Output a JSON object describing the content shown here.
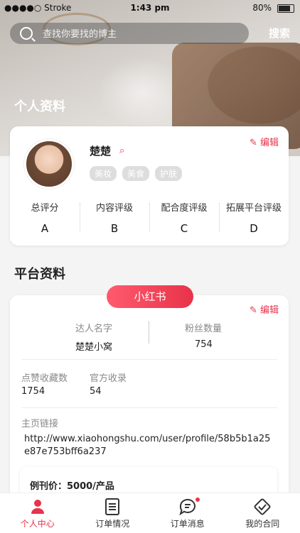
{
  "status_bar": {
    "carrier": "●●●●○ Stroke",
    "time": "1:43 pm",
    "battery": "80%"
  },
  "search": {
    "placeholder": "查找你要找的博主",
    "button_label": "搜索"
  },
  "personal": {
    "section_title": "个人资料",
    "edit_label": "编辑",
    "name": "楚楚",
    "tags": [
      "美妆",
      "美食",
      "护肤"
    ],
    "grades": [
      {
        "label": "总评分",
        "value": "A"
      },
      {
        "label": "内容评级",
        "value": "B"
      },
      {
        "label": "配合度评级",
        "value": "C"
      },
      {
        "label": "拓展平台评级",
        "value": "D"
      }
    ]
  },
  "platform": {
    "section_title": "平台资料",
    "platform_name": "小红书",
    "edit_label": "编辑",
    "creator_name_label": "达人名字",
    "creator_name": "楚楚小窝",
    "followers_label": "粉丝数量",
    "followers": "754",
    "likes_label": "点赞收藏数",
    "likes": "1754",
    "official_label": "官方收录",
    "official": "54",
    "homepage_label": "主页链接",
    "homepage_url": "http://www.xiaohongshu.com/user/profile/58b5b1a25e87e753bff6a237",
    "price_label": "例刊价：5000/产品"
  },
  "tabbar": {
    "items": [
      {
        "label": "个人中心",
        "icon": "person-icon",
        "active": true
      },
      {
        "label": "订单情况",
        "icon": "document-icon",
        "active": false
      },
      {
        "label": "订单消息",
        "icon": "chat-icon",
        "active": false
      },
      {
        "label": "我的合同",
        "icon": "handshake-icon",
        "active": false
      }
    ]
  },
  "colors": {
    "accent": "#e8334a"
  }
}
